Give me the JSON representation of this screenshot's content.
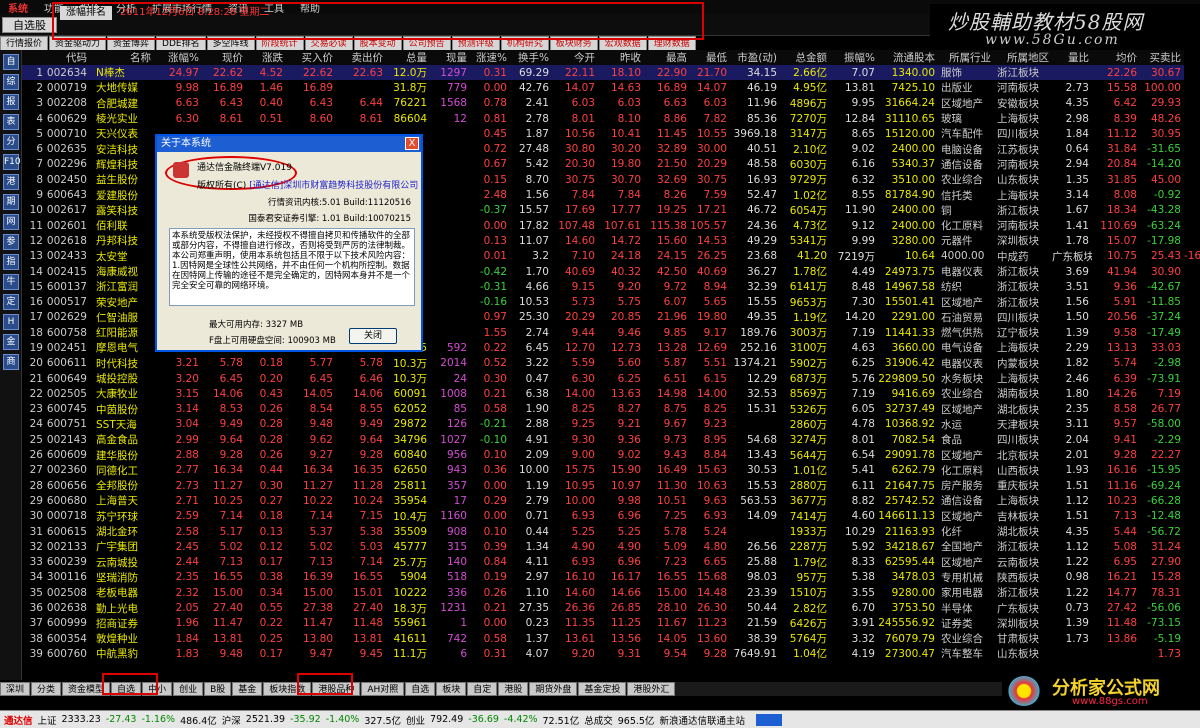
{
  "menubar": {
    "items": [
      "系统",
      "功能",
      "报价",
      "分析",
      "扩展市场行情",
      "资讯",
      "工具",
      "帮助"
    ]
  },
  "topbar": {
    "favorites_label": "自选股",
    "rank_label": "涨幅排名",
    "datetime": "2011年12月6日 8:28:28 星期二"
  },
  "tabs": [
    {
      "label": "行情报价",
      "red": false
    },
    {
      "label": "资金驱动力",
      "red": false
    },
    {
      "label": "资金博弈",
      "red": false
    },
    {
      "label": "DDE排名",
      "red": false
    },
    {
      "label": "多空阵线",
      "red": false
    },
    {
      "label": "阶段统计",
      "red": true
    },
    {
      "label": "交易必读",
      "red": true
    },
    {
      "label": "股本变动",
      "red": true
    },
    {
      "label": "公司预告",
      "red": true
    },
    {
      "label": "预测评级",
      "red": true
    },
    {
      "label": "机构研究",
      "red": true
    },
    {
      "label": "板块财务",
      "red": true
    },
    {
      "label": "宏观数据",
      "red": true
    },
    {
      "label": "理财数据",
      "red": true
    }
  ],
  "logo": {
    "line1": "炒股輔助教材58股网",
    "line2": "www.58Gu.com"
  },
  "table": {
    "columns": [
      "",
      "代码",
      "名称",
      "涨幅%",
      "现价",
      "涨跌",
      "买入价",
      "卖出价",
      "总量",
      "现量",
      "涨速%",
      "换手%",
      "今开",
      "昨收",
      "最高",
      "最低",
      "市盈(动)",
      "总金额",
      "振幅%",
      "流通股本",
      "所属行业",
      "所属地区",
      "量比",
      "均价",
      "买卖比"
    ],
    "rows": [
      [
        "1",
        "002634",
        "N棒杰",
        "24.97",
        "22.62",
        "4.52",
        "22.62",
        "22.63",
        "12.0万",
        "1297",
        "0.31",
        "69.29",
        "22.11",
        "18.10",
        "22.90",
        "21.70",
        "34.15",
        "2.66亿",
        "7.07",
        "1340.00",
        "服饰",
        "浙江板块",
        "",
        "22.26",
        "30.67"
      ],
      [
        "2",
        "000719",
        "大地传媒",
        "9.98",
        "16.89",
        "1.46",
        "16.89",
        "",
        "31.8万",
        "779",
        "0.00",
        "42.76",
        "14.07",
        "14.63",
        "16.89",
        "14.07",
        "46.19",
        "4.95亿",
        "13.81",
        "7425.10",
        "出版业",
        "河南板块",
        "2.73",
        "15.58",
        "100.00"
      ],
      [
        "3",
        "002208",
        "合肥城建",
        "6.63",
        "6.43",
        "0.40",
        "6.43",
        "6.44",
        "76221",
        "1568",
        "0.78",
        "2.41",
        "6.03",
        "6.03",
        "6.63",
        "6.03",
        "11.96",
        "4896万",
        "9.95",
        "31664.24",
        "区域地产",
        "安徽板块",
        "4.35",
        "6.42",
        "29.93"
      ],
      [
        "4",
        "600629",
        "棱光实业",
        "6.30",
        "8.61",
        "0.51",
        "8.60",
        "8.61",
        "86604",
        "12",
        "0.81",
        "2.78",
        "8.01",
        "8.10",
        "8.86",
        "7.82",
        "85.36",
        "7270万",
        "12.84",
        "31110.65",
        "玻璃",
        "上海板块",
        "2.98",
        "8.39",
        "48.26"
      ],
      [
        "5",
        "000710",
        "天兴仪表",
        "",
        "",
        "",
        "",
        "",
        "",
        "",
        "0.45",
        "1.87",
        "10.56",
        "10.41",
        "11.45",
        "10.55",
        "3969.18",
        "3147万",
        "8.65",
        "15120.00",
        "汽车配件",
        "四川板块",
        "1.84",
        "11.12",
        "30.95"
      ],
      [
        "6",
        "002635",
        "安洁科技",
        "",
        "",
        "",
        "",
        "",
        "",
        "",
        "0.72",
        "27.48",
        "30.80",
        "30.20",
        "32.89",
        "30.00",
        "40.51",
        "2.10亿",
        "9.02",
        "2400.00",
        "电脑设备",
        "江苏板块",
        "0.64",
        "31.84",
        "-31.65"
      ],
      [
        "7",
        "002296",
        "辉煌科技",
        "",
        "",
        "",
        "",
        "",
        "",
        "",
        "0.67",
        "5.42",
        "20.30",
        "19.80",
        "21.50",
        "20.29",
        "48.58",
        "6030万",
        "6.16",
        "5340.37",
        "通信设备",
        "河南板块",
        "2.94",
        "20.84",
        "-14.20"
      ],
      [
        "8",
        "002450",
        "益生股份",
        "",
        "",
        "",
        "",
        "",
        "",
        "",
        "0.15",
        "8.70",
        "30.75",
        "30.70",
        "32.69",
        "30.75",
        "16.93",
        "9729万",
        "6.32",
        "3510.00",
        "农业综合",
        "山东板块",
        "1.35",
        "31.85",
        "45.00"
      ],
      [
        "9",
        "600643",
        "爱建股份",
        "",
        "",
        "",
        "",
        "",
        "",
        "",
        "2.48",
        "1.56",
        "7.84",
        "7.84",
        "8.26",
        "7.59",
        "52.47",
        "1.02亿",
        "8.55",
        "81784.90",
        "信托类",
        "上海板块",
        "3.14",
        "8.08",
        "-0.92"
      ],
      [
        "10",
        "002617",
        "露笑科技",
        "",
        "",
        "",
        "",
        "",
        "",
        "",
        "-0.37",
        "15.57",
        "17.69",
        "17.77",
        "19.25",
        "17.21",
        "46.72",
        "6054万",
        "11.90",
        "2400.00",
        "铜",
        "浙江板块",
        "1.67",
        "18.34",
        "-43.28"
      ],
      [
        "11",
        "002601",
        "佰利联",
        "",
        "",
        "",
        "",
        "",
        "",
        "",
        "0.00",
        "17.82",
        "107.48",
        "107.61",
        "115.38",
        "105.57",
        "24.36",
        "4.73亿",
        "9.12",
        "2400.00",
        "化工原料",
        "河南板块",
        "1.41",
        "110.69",
        "-63.24"
      ],
      [
        "12",
        "002618",
        "丹邦科技",
        "",
        "",
        "",
        "",
        "",
        "",
        "",
        "0.13",
        "11.07",
        "14.60",
        "14.72",
        "15.60",
        "14.53",
        "49.29",
        "5341万",
        "9.99",
        "3280.00",
        "元器件",
        "深圳板块",
        "1.78",
        "15.07",
        "-17.98"
      ],
      [
        "13",
        "002433",
        "太安堂",
        "",
        "",
        "",
        "",
        "",
        "",
        "",
        "0.01",
        "3.2",
        "7.10",
        "24.18",
        "24.15",
        "26.25",
        "23.68",
        "41.20",
        "7219万",
        "10.64",
        "4000.00",
        "中成药",
        "广东板块",
        "10.75",
        "25.43",
        "-16.93"
      ],
      [
        "14",
        "002415",
        "海康威视",
        "",
        "",
        "",
        "",
        "",
        "",
        "",
        "-0.42",
        "1.70",
        "40.69",
        "40.32",
        "42.50",
        "40.69",
        "36.27",
        "1.78亿",
        "4.49",
        "24973.75",
        "电器仪表",
        "浙江板块",
        "3.69",
        "41.94",
        "30.90"
      ],
      [
        "15",
        "600137",
        "浙江富润",
        "",
        "",
        "",
        "",
        "",
        "",
        "",
        "-0.31",
        "4.66",
        "9.15",
        "9.20",
        "9.72",
        "8.94",
        "32.39",
        "6141万",
        "8.48",
        "14967.58",
        "纺织",
        "浙江板块",
        "3.51",
        "9.36",
        "-42.67"
      ],
      [
        "16",
        "000517",
        "荣安地产",
        "",
        "",
        "",
        "",
        "",
        "",
        "",
        "-0.16",
        "10.53",
        "5.73",
        "5.75",
        "6.07",
        "5.65",
        "15.55",
        "9653万",
        "7.30",
        "15501.41",
        "区域地产",
        "浙江板块",
        "1.56",
        "5.91",
        "-11.85"
      ],
      [
        "17",
        "002629",
        "仁智油服",
        "",
        "",
        "",
        "",
        "",
        "",
        "",
        "0.97",
        "25.30",
        "20.29",
        "20.85",
        "21.96",
        "19.80",
        "49.35",
        "1.19亿",
        "14.20",
        "2291.00",
        "石油贸易",
        "四川板块",
        "1.50",
        "20.56",
        "-37.24"
      ],
      [
        "18",
        "600758",
        "红阳能源",
        "",
        "",
        "",
        "",
        "",
        "",
        "",
        "1.55",
        "2.74",
        "9.44",
        "9.46",
        "9.85",
        "9.17",
        "189.76",
        "3003万",
        "7.19",
        "11441.33",
        "燃气供热",
        "辽宁板块",
        "1.39",
        "9.58",
        "-17.49"
      ],
      [
        "19",
        "002451",
        "摩恩电气",
        "3.30",
        "13.15",
        "0.42",
        "13.14",
        "13.15",
        "23615",
        "592",
        "0.22",
        "6.45",
        "12.70",
        "12.73",
        "13.28",
        "12.69",
        "252.16",
        "3100万",
        "4.63",
        "3660.00",
        "电气设备",
        "上海板块",
        "2.29",
        "13.13",
        "33.03"
      ],
      [
        "20",
        "600611",
        "时代科技",
        "3.21",
        "5.78",
        "0.18",
        "5.77",
        "5.78",
        "10.3万",
        "2014",
        "0.52",
        "3.22",
        "5.59",
        "5.60",
        "5.87",
        "5.51",
        "1374.21",
        "5902万",
        "6.25",
        "31906.42",
        "电器仪表",
        "内蒙板块",
        "1.82",
        "5.74",
        "-2.98"
      ],
      [
        "21",
        "600649",
        "城投控股",
        "3.20",
        "6.45",
        "0.20",
        "6.45",
        "6.46",
        "10.3万",
        "24",
        "0.30",
        "0.47",
        "6.30",
        "6.25",
        "6.51",
        "6.15",
        "12.29",
        "6873万",
        "5.76",
        "229809.50",
        "水务板块",
        "上海板块",
        "2.46",
        "6.39",
        "-73.91"
      ],
      [
        "22",
        "002505",
        "大康牧业",
        "3.15",
        "14.06",
        "0.43",
        "14.05",
        "14.06",
        "60091",
        "1008",
        "0.21",
        "6.38",
        "14.00",
        "13.63",
        "14.98",
        "14.00",
        "32.53",
        "8569万",
        "7.19",
        "9416.69",
        "农业综合",
        "湖南板块",
        "1.80",
        "14.26",
        "7.19"
      ],
      [
        "23",
        "600745",
        "中茵股份",
        "3.14",
        "8.53",
        "0.26",
        "8.54",
        "8.55",
        "62052",
        "85",
        "0.58",
        "1.90",
        "8.25",
        "8.27",
        "8.75",
        "8.25",
        "15.31",
        "5326万",
        "6.05",
        "32737.49",
        "区域地产",
        "湖北板块",
        "2.35",
        "8.58",
        "26.77"
      ],
      [
        "24",
        "600751",
        "SST天海",
        "3.04",
        "9.49",
        "0.28",
        "9.48",
        "9.49",
        "29872",
        "126",
        "-0.21",
        "2.88",
        "9.25",
        "9.21",
        "9.67",
        "9.23",
        "",
        "2860万",
        "4.78",
        "10368.92",
        "水运",
        "天津板块",
        "3.11",
        "9.57",
        "-58.00"
      ],
      [
        "25",
        "002143",
        "高金食品",
        "2.99",
        "9.64",
        "0.28",
        "9.62",
        "9.64",
        "34796",
        "1027",
        "-0.10",
        "4.91",
        "9.30",
        "9.36",
        "9.73",
        "8.95",
        "54.68",
        "3274万",
        "8.01",
        "7082.54",
        "食品",
        "四川板块",
        "2.04",
        "9.41",
        "-2.29"
      ],
      [
        "26",
        "600609",
        "建华股份",
        "2.88",
        "9.28",
        "0.26",
        "9.27",
        "9.28",
        "60840",
        "956",
        "0.10",
        "2.09",
        "9.00",
        "9.02",
        "9.43",
        "8.84",
        "13.43",
        "5644万",
        "6.54",
        "29091.78",
        "区域地产",
        "北京板块",
        "2.01",
        "9.28",
        "22.27"
      ],
      [
        "27",
        "002360",
        "同德化工",
        "2.77",
        "16.34",
        "0.44",
        "16.34",
        "16.35",
        "62650",
        "943",
        "0.36",
        "10.00",
        "15.75",
        "15.90",
        "16.49",
        "15.63",
        "30.53",
        "1.01亿",
        "5.41",
        "6262.79",
        "化工原料",
        "山西板块",
        "1.93",
        "16.16",
        "-15.95"
      ],
      [
        "28",
        "600656",
        "全邦股份",
        "2.73",
        "11.27",
        "0.30",
        "11.27",
        "11.28",
        "25811",
        "357",
        "0.00",
        "1.19",
        "10.95",
        "10.97",
        "11.30",
        "10.63",
        "15.53",
        "2880万",
        "6.11",
        "21647.75",
        "房产服务",
        "重庆板块",
        "1.51",
        "11.16",
        "-69.24"
      ],
      [
        "29",
        "600680",
        "上海普天",
        "2.71",
        "10.25",
        "0.27",
        "10.22",
        "10.24",
        "35954",
        "17",
        "0.29",
        "2.79",
        "10.00",
        "9.98",
        "10.51",
        "9.63",
        "563.53",
        "3677万",
        "8.82",
        "25742.52",
        "通信设备",
        "上海板块",
        "1.12",
        "10.23",
        "-66.28"
      ],
      [
        "30",
        "000718",
        "苏宁环球",
        "2.59",
        "7.14",
        "0.18",
        "7.14",
        "7.15",
        "10.4万",
        "1160",
        "0.00",
        "0.71",
        "6.93",
        "6.96",
        "7.25",
        "6.93",
        "14.09",
        "7414万",
        "4.60",
        "146611.13",
        "区域地产",
        "吉林板块",
        "1.51",
        "7.13",
        "-12.48"
      ],
      [
        "31",
        "600615",
        "湖北金环",
        "2.58",
        "5.17",
        "0.13",
        "5.37",
        "5.38",
        "35509",
        "908",
        "0.10",
        "0.44",
        "5.25",
        "5.25",
        "5.78",
        "5.24",
        "",
        "1933万",
        "10.29",
        "21163.93",
        "化纤",
        "湖北板块",
        "4.35",
        "5.44",
        "-56.72"
      ],
      [
        "32",
        "002133",
        "广宇集团",
        "2.45",
        "5.02",
        "0.12",
        "5.02",
        "5.03",
        "45777",
        "315",
        "0.39",
        "1.34",
        "4.90",
        "4.90",
        "5.09",
        "4.80",
        "26.56",
        "2287万",
        "5.92",
        "34218.67",
        "全国地产",
        "浙江板块",
        "1.12",
        "5.08",
        "31.24"
      ],
      [
        "33",
        "600239",
        "云南城投",
        "2.44",
        "7.13",
        "0.17",
        "7.13",
        "7.14",
        "25.7万",
        "140",
        "0.84",
        "4.11",
        "6.93",
        "6.96",
        "7.23",
        "6.65",
        "25.88",
        "1.79亿",
        "8.33",
        "62595.44",
        "区域地产",
        "云南板块",
        "1.22",
        "6.95",
        "27.90"
      ],
      [
        "34",
        "300116",
        "坚瑞消防",
        "2.35",
        "16.55",
        "0.38",
        "16.39",
        "16.55",
        "5904",
        "518",
        "0.19",
        "2.97",
        "16.10",
        "16.17",
        "16.55",
        "15.68",
        "98.03",
        "957万",
        "5.38",
        "3478.03",
        "专用机械",
        "陕西板块",
        "0.98",
        "16.21",
        "15.28"
      ],
      [
        "35",
        "002508",
        "老板电器",
        "2.32",
        "15.00",
        "0.34",
        "15.00",
        "15.01",
        "10222",
        "336",
        "0.26",
        "1.10",
        "14.60",
        "14.66",
        "15.00",
        "14.48",
        "23.39",
        "1510万",
        "3.55",
        "9280.00",
        "家用电器",
        "浙江板块",
        "1.22",
        "14.77",
        "78.31"
      ],
      [
        "36",
        "002638",
        "勤上光电",
        "2.05",
        "27.40",
        "0.55",
        "27.38",
        "27.40",
        "18.3万",
        "1231",
        "0.21",
        "27.35",
        "26.36",
        "26.85",
        "28.10",
        "26.30",
        "50.44",
        "2.82亿",
        "6.70",
        "3753.50",
        "半导体",
        "广东板块",
        "0.73",
        "27.42",
        "-56.06"
      ],
      [
        "37",
        "600999",
        "招商证券",
        "1.96",
        "11.47",
        "0.22",
        "11.47",
        "11.48",
        "55961",
        "1",
        "0.00",
        "0.23",
        "11.35",
        "11.25",
        "11.67",
        "11.23",
        "21.59",
        "6426万",
        "3.91",
        "245556.92",
        "证券类",
        "深圳板块",
        "1.39",
        "11.48",
        "-73.15"
      ],
      [
        "38",
        "600354",
        "敦煌种业",
        "1.84",
        "13.81",
        "0.25",
        "13.80",
        "13.81",
        "41611",
        "742",
        "0.58",
        "1.37",
        "13.61",
        "13.56",
        "14.05",
        "13.60",
        "38.39",
        "5764万",
        "3.32",
        "76079.79",
        "农业综合",
        "甘肃板块",
        "1.73",
        "13.86",
        "-5.19"
      ],
      [
        "39",
        "600760",
        "中航黑豹",
        "1.83",
        "9.48",
        "0.17",
        "9.47",
        "9.45",
        "11.1万",
        "6",
        "0.31",
        "4.07",
        "9.20",
        "9.31",
        "9.54",
        "9.28",
        "7649.91",
        "1.04亿",
        "4.19",
        "27300.47",
        "汽车整车",
        "山东板块",
        "",
        "",
        "1.73"
      ]
    ]
  },
  "dialog": {
    "title": "关于本系统",
    "close": "X",
    "version": "通达信金融终端V7.019",
    "copyright_prefix": "版权所有(C)",
    "copyright_owner": "[通达信]深圳市财富趋势科技股份有限公司",
    "info1": "行情资讯内核:5.01 Build:11120516",
    "info2": "国泰君安证券引擎: 1.01 Build:10070215",
    "notice": "本系统受版权法保护，未经授权不得擅自拷贝和传播软件的全部或部分内容，不得擅自进行修改，否则将受到严厉的法律制裁。本公司郑重声明，使用本系统包括且不限于以下技术风险内容：1.因特网是全球性公共网络，并不由任何一个机构所控制。数据在因特网上传输的途径不是完全确定的，因特网本身并不是一个完全安全可靠的网络环境。",
    "mem": "最大可用内存: 3327 MB",
    "disk": "F盘上可用硬盘空间: 100903 MB",
    "ok": "关闭"
  },
  "sidebar": {
    "items": [
      "自",
      "综",
      "报",
      "表",
      "分",
      "F10",
      "港",
      "期",
      "网",
      "参",
      "指",
      "牛",
      "定",
      "H",
      "金",
      "商"
    ]
  },
  "bottom_tabs": [
    "深圳",
    "分类",
    "资金模型",
    "自选",
    "中小",
    "创业",
    "B股",
    "基金",
    "板块指数",
    "港股品种",
    "AH对照",
    "自选",
    "板块",
    "自定",
    "港股",
    "期货外盘",
    "基金定投",
    "港股外汇"
  ],
  "status": {
    "logo": "通达信",
    "sh_label": "上证",
    "sh_index": "2333.23",
    "sh_change": "-27.43",
    "sh_pct": "-1.16%",
    "sh_amt": "486.4亿",
    "sz_label": "沪深",
    "sz_index": "2521.39",
    "sz_change": "-35.92",
    "sz_pct": "-1.40%",
    "sz_amt": "327.5亿",
    "cy_label": "创业",
    "cy_index": "792.49",
    "cy_change": "-36.69",
    "cy_pct": "-4.42%",
    "cy_amt": "72.51亿",
    "total_label": "总成交",
    "total": "965.5亿",
    "server": "新浪通达信联通主站"
  },
  "watermark": {
    "line1": "分析家公式网",
    "line2": "www.88gs.com"
  }
}
